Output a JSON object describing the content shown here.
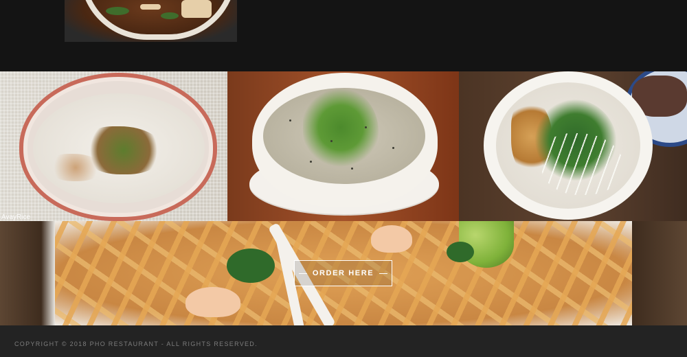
{
  "top_image": {
    "alt_name": "pho-bowl-photo"
  },
  "gallery": [
    {
      "name": "congee-photo",
      "credit": "AvayRice"
    },
    {
      "name": "soup-bowl-photo"
    },
    {
      "name": "porridge-with-youtiao-photo"
    }
  ],
  "order": {
    "label": "ORDER HERE"
  },
  "footer": {
    "copyright": "COPYRIGHT © 2018 PHO RESTAURANT - ALL RIGHTS RESERVED."
  },
  "colors": {
    "background": "#141414",
    "footer_bg": "#232323",
    "footer_text": "#7d7d7d",
    "button_border": "#ffffff"
  }
}
